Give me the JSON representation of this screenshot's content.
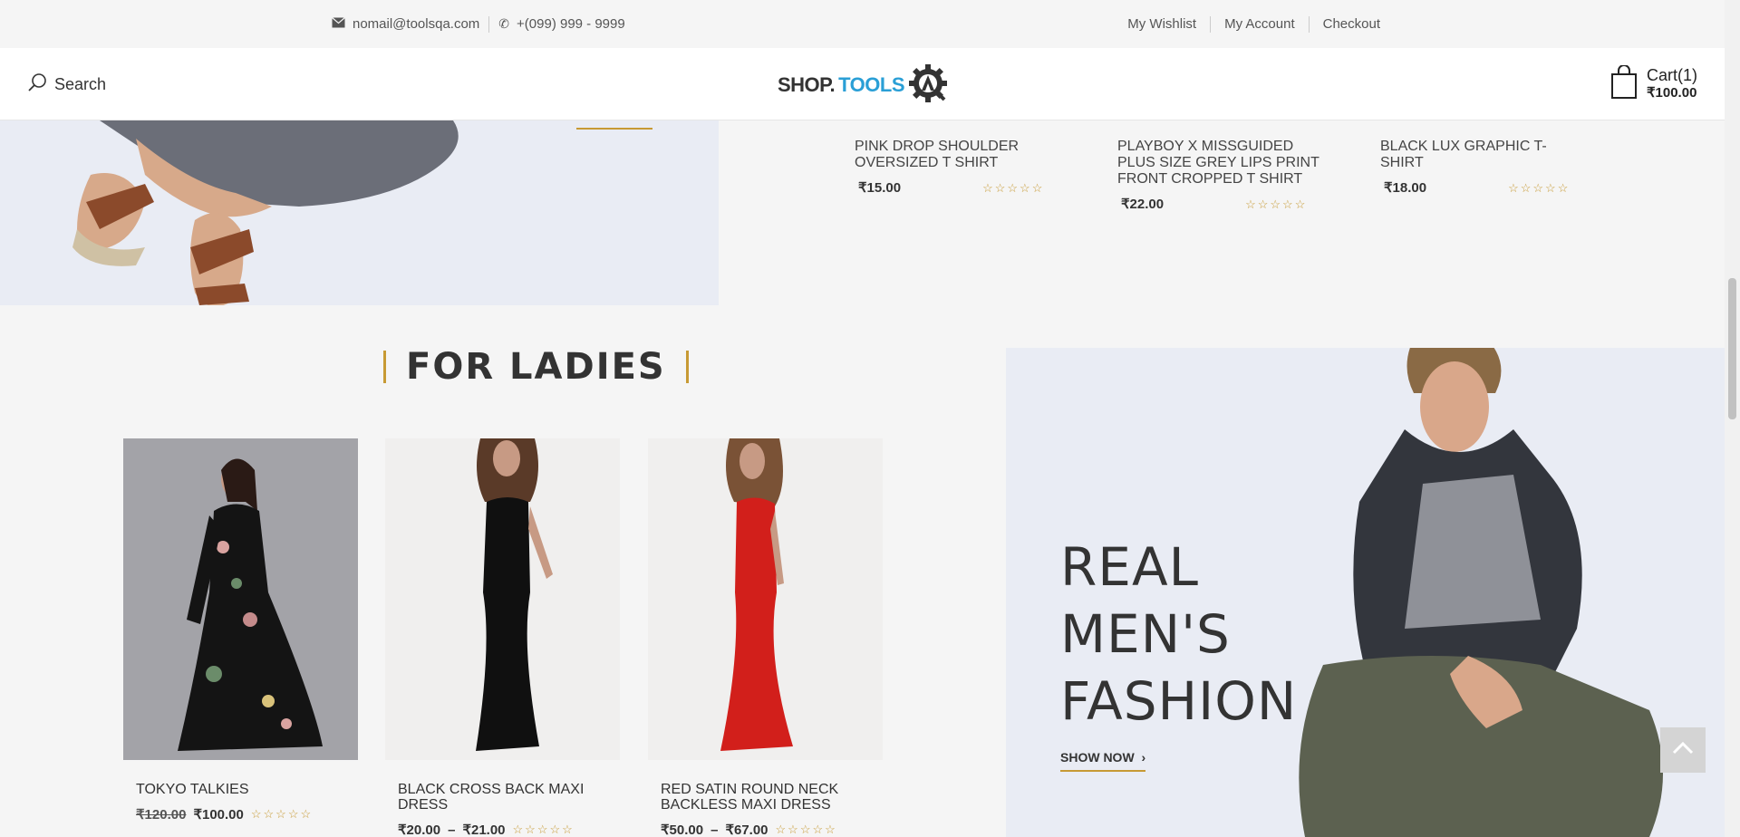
{
  "topbar": {
    "email": "nomail@toolsqa.com",
    "phone": "+(099) 999 - 9999",
    "links": [
      "My Wishlist",
      "My Account",
      "Checkout"
    ]
  },
  "header": {
    "search_label": "Search",
    "logo_part1": "SHOP.",
    "logo_part2": "TOOLS",
    "cart_label": "Cart(1)",
    "cart_total": "₹100.00"
  },
  "top_products": [
    {
      "name": "PINK DROP SHOULDER OVERSIZED T SHIRT",
      "price": "₹15.00"
    },
    {
      "name": "PLAYBOY X MISSGUIDED PLUS SIZE GREY LIPS PRINT FRONT CROPPED T SHIRT",
      "price": "₹22.00"
    },
    {
      "name": "BLACK LUX GRAPHIC T-SHIRT",
      "price": "₹18.00"
    }
  ],
  "section_title": "FOR LADIES",
  "ladies_products": [
    {
      "name": "TOKYO TALKIES",
      "old_price": "₹120.00",
      "price": "₹100.00"
    },
    {
      "name": "BLACK CROSS BACK MAXI DRESS",
      "price_from": "₹20.00",
      "dash": "–",
      "price_to": "₹21.00"
    },
    {
      "name": "RED SATIN ROUND NECK BACKLESS MAXI DRESS",
      "price_from": "₹50.00",
      "dash": "–",
      "price_to": "₹67.00"
    }
  ],
  "stars": "☆☆☆☆☆",
  "men_banner": {
    "line1": "REAL",
    "line2": "MEN'S",
    "line3": "FASHION",
    "cta": "SHOW NOW",
    "cta_arrow": "›"
  },
  "colors": {
    "accent": "#c79a34",
    "banner_bg": "#e9ecf4",
    "logo_blue": "#2a9fd6"
  }
}
